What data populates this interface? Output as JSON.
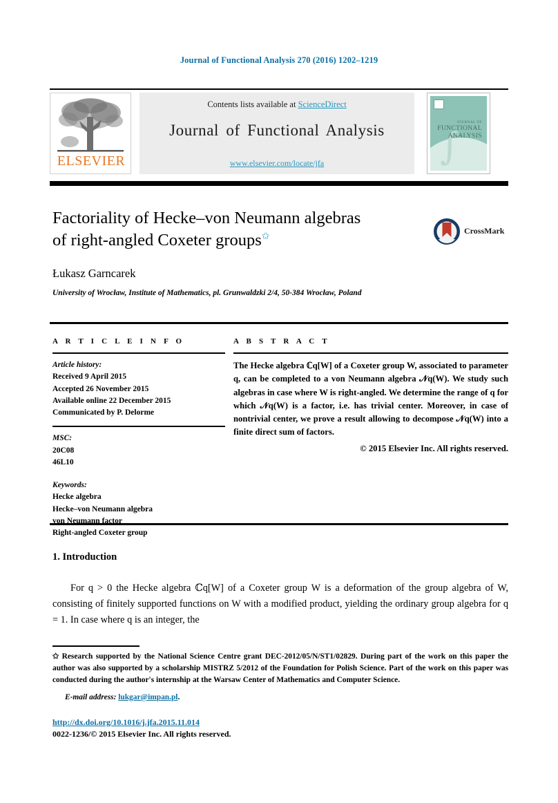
{
  "running_head": "Journal of Functional Analysis 270 (2016) 1202–1219",
  "masthead": {
    "contents_prefix": "Contents lists available at ",
    "sciencedirect": "ScienceDirect",
    "journal_name": "Journal of Functional Analysis",
    "journal_url": "www.elsevier.com/locate/jfa",
    "publisher_logo_word": "ELSEVIER",
    "cover": {
      "line1": "JOURNAL OF",
      "line2": "FUNCTIONAL",
      "line3": "ANALYSIS",
      "integral_glyph": "∫"
    }
  },
  "article": {
    "title_line1": "Factoriality of Hecke–von Neumann algebras",
    "title_line2": "of right-angled Coxeter groups",
    "title_footnote_marker": "✩",
    "author": "Łukasz Garncarek",
    "affiliation": "University of Wrocław, Institute of Mathematics, pl. Grunwaldzki 2/4, 50-384 Wrocław, Poland",
    "crossmark_label": "CrossMark"
  },
  "info": {
    "heading": "A R T I C L E   I N F O",
    "history_label": "Article history:",
    "history": [
      "Received 9 April 2015",
      "Accepted 26 November 2015",
      "Available online 22 December 2015",
      "Communicated by P. Delorme"
    ],
    "msc_label": "MSC:",
    "msc": [
      "20C08",
      "46L10"
    ],
    "keywords_label": "Keywords:",
    "keywords": [
      "Hecke algebra",
      "Hecke–von Neumann algebra",
      "von Neumann factor",
      "Right-angled Coxeter group"
    ]
  },
  "abstract": {
    "heading": "A B S T R A C T",
    "text_part1": "The Hecke algebra ",
    "math_cq": "ℂ",
    "math_cq_sub": "q",
    "text_part2": "[W] of a Coxeter group W, associated to parameter q, can be completed to a von Neumann algebra 𝒩q(W). We study such algebras in case where W is right-angled. We determine the range of q for which 𝒩q(W) is a factor, i.e. has trivial center. Moreover, in case of nontrivial center, we prove a result allowing to decompose 𝒩q(W) into a finite direct sum of factors.",
    "copyright": "© 2015 Elsevier Inc. All rights reserved."
  },
  "introduction": {
    "heading": "1.  Introduction",
    "paragraph": "For q > 0 the Hecke algebra ℂq[W] of a Coxeter group W is a deformation of the group algebra of W, consisting of finitely supported functions on W with a modified product, yielding the ordinary group algebra for q = 1. In case where q is an integer, the"
  },
  "footer": {
    "footnote_marker": "✩",
    "footnote": "Research supported by the National Science Centre grant DEC-2012/05/N/ST1/02829. During part of the work on this paper the author was also supported by a scholarship MISTRZ 5/2012 of the Foundation for Polish Science. Part of the work on this paper was conducted during the author's internship at the Warsaw Center of Mathematics and Computer Science.",
    "email_label": "E-mail address:",
    "email_address": "lukgar@impan.pl",
    "email_period": ".",
    "doi": "http://dx.doi.org/10.1016/j.jfa.2015.11.014",
    "issn": "0022-1236/© 2015 Elsevier Inc. All rights reserved."
  },
  "colors": {
    "link_blue": "#0b6fa4",
    "science_direct_blue": "#2596be",
    "elsevier_orange": "#e87722",
    "cover_teal": "#8cc3b6",
    "crossmark_red": "#c0392b",
    "crossmark_navy": "#1a3b66"
  }
}
